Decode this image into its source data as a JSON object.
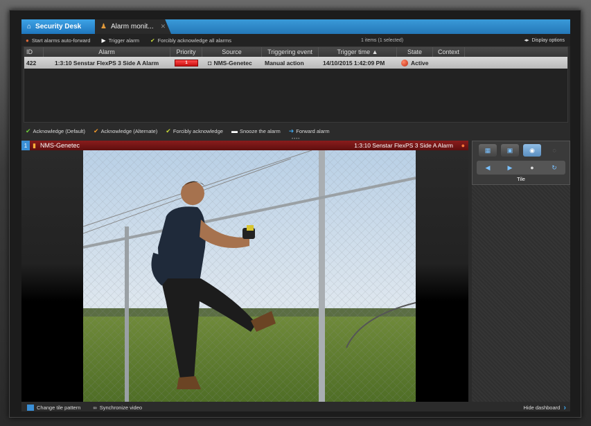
{
  "tabs": [
    {
      "label": "Security Desk",
      "icon": "home-icon"
    },
    {
      "label": "Alarm monit...",
      "icon": "alarm-person-icon",
      "close": "✕"
    }
  ],
  "toolbar": {
    "start_auto_forward": "Start alarms auto-forward",
    "trigger_alarm": "Trigger alarm",
    "force_ack_all": "Forcibly acknowledge all alarms",
    "item_count": "1 items (1 selected)",
    "display_options": "Display options"
  },
  "table": {
    "headers": [
      "ID",
      "Alarm",
      "Priority",
      "Source",
      "Triggering event",
      "Trigger time ▲",
      "State",
      "Context"
    ],
    "rows": [
      {
        "id": "422",
        "alarm": "1:3:10 Senstar FlexPS 3 Side A Alarm",
        "priority": "1",
        "source": "NMS-Genetec",
        "triggering_event": "Manual action",
        "trigger_time": "14/10/2015 1:42:09 PM",
        "state": "Active",
        "context": ""
      }
    ]
  },
  "actions": {
    "ack_default": "Acknowledge (Default)",
    "ack_alternate": "Acknowledge (Alternate)",
    "force_ack": "Forcibly acknowledge",
    "snooze": "Snooze the alarm",
    "forward": "Forward alarm"
  },
  "tile": {
    "number": "1",
    "camera_name": "NMS-Genetec",
    "alarm_name": "1:3:10 Senstar FlexPS 3 Side A Alarm"
  },
  "dashboard": {
    "label": "Tile"
  },
  "bottombar": {
    "change_tile_pattern": "Change tile pattern",
    "sync_video": "Synchronize video",
    "hide_dashboard": "Hide dashboard"
  },
  "colors": {
    "accent": "#2a8ad4",
    "alarm_red": "#8a1c1c",
    "priority_red": "#e52222",
    "row_selected": "#c8c8c8"
  }
}
